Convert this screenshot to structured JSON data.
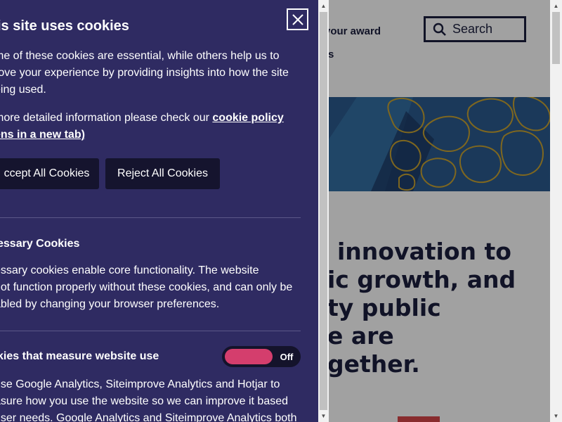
{
  "page": {
    "nav_award": "your award",
    "nav_items": "ts",
    "search_placeholder": "Search",
    "headline_lines": [
      "innovation to",
      "ic growth, and",
      "ty public",
      "e are",
      "gether."
    ]
  },
  "cookie_panel": {
    "title": "is site uses cookies",
    "intro_lines": [
      "me of these cookies are essential, while others help us to",
      "rove your experience by providing insights into how the site",
      "eing used."
    ],
    "detail_prefix": "more detailed information please check our ",
    "policy_link_line1": "cookie policy",
    "policy_link_line2": "ens in a new tab)",
    "accept_label": "ccept All Cookies",
    "reject_label": "Reject All Cookies",
    "necessary": {
      "title": "essary Cookies",
      "lines": [
        "essary cookies enable core functionality. The website",
        "not function properly without these cookies, and can only be",
        "abled by changing your browser preferences."
      ]
    },
    "analytics": {
      "title": "kies that measure website use",
      "toggle_state": "Off",
      "lines": [
        "use Google Analytics, Siteimprove Analytics and Hotjar to",
        "asure how you use the website so we can improve it based",
        "user needs. Google Analytics and Siteimprove Analytics both"
      ]
    },
    "close_label": "close-icon"
  },
  "colors": {
    "panel_bg": "#2f2b62",
    "button_bg": "#15142e",
    "toggle_knob": "#d43e6d",
    "text_dark": "#1b1f3f"
  }
}
